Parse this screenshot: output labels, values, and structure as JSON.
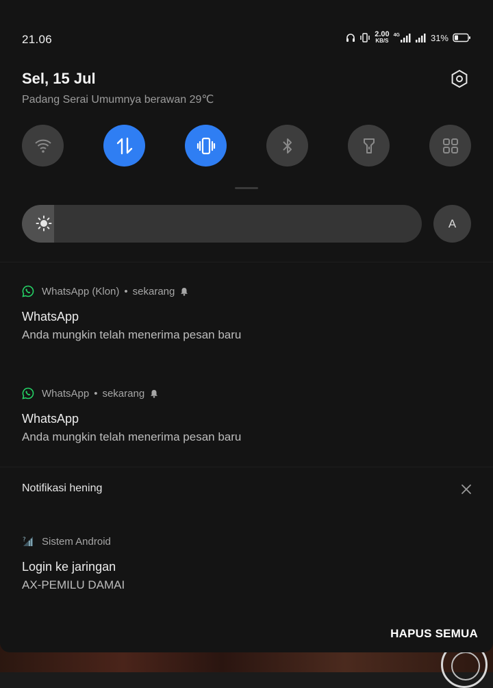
{
  "status_bar": {
    "time": "21.06",
    "speed_value": "2.00",
    "speed_unit": "KB/S",
    "network_type": "4G",
    "battery_percent": "31%"
  },
  "header": {
    "date": "Sel, 15 Jul",
    "weather": "Padang Serai Umumnya berawan 29℃"
  },
  "quick_toggles": [
    {
      "name": "wifi",
      "icon": "wifi-icon",
      "active": false
    },
    {
      "name": "mobile-data",
      "icon": "data-arrows-icon",
      "active": true
    },
    {
      "name": "vibrate",
      "icon": "vibrate-icon",
      "active": true
    },
    {
      "name": "bluetooth",
      "icon": "bluetooth-icon",
      "active": false
    },
    {
      "name": "flashlight",
      "icon": "flashlight-icon",
      "active": false
    },
    {
      "name": "edit-tiles",
      "icon": "grid-icon",
      "active": false
    }
  ],
  "brightness": {
    "level": 0.08,
    "auto_label": "A"
  },
  "notifications": [
    {
      "app": "WhatsApp (Klon)",
      "time": "sekarang",
      "title": "WhatsApp",
      "text": "Anda mungkin telah menerima pesan baru"
    },
    {
      "app": "WhatsApp",
      "time": "sekarang",
      "title": "WhatsApp",
      "text": "Anda mungkin telah menerima pesan baru"
    }
  ],
  "silent_section": {
    "label": "Notifikasi hening",
    "notification": {
      "app": "Sistem Android",
      "title": "Login ke jaringan",
      "text": "AX-PEMILU DAMAI"
    }
  },
  "clear_all_label": "HAPUS SEMUA",
  "colors": {
    "accent": "#2f7ef3",
    "whatsapp": "#25d366",
    "shade_bg": "#141414"
  }
}
